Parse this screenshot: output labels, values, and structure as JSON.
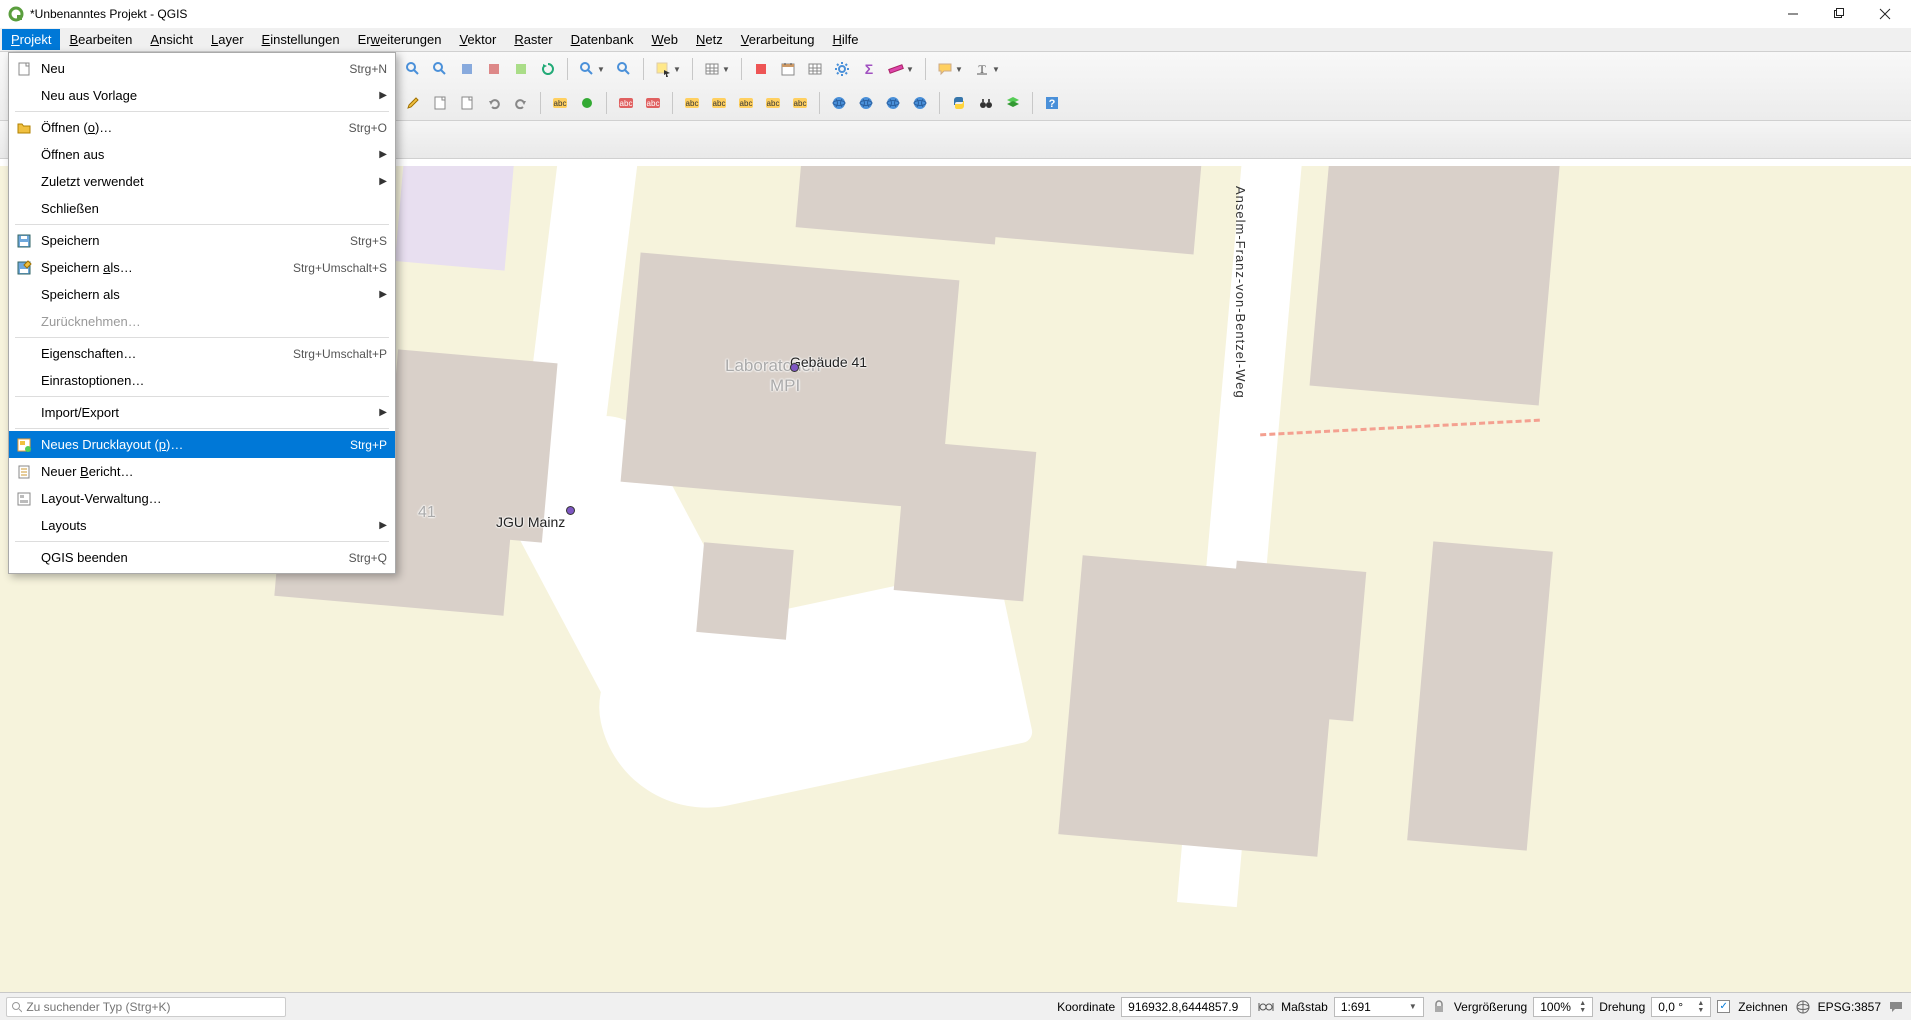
{
  "window": {
    "title": "*Unbenanntes Projekt - QGIS"
  },
  "menubar": {
    "items": [
      {
        "label": "Projekt",
        "accel_index": 0,
        "active": true
      },
      {
        "label": "Bearbeiten",
        "accel_index": 0
      },
      {
        "label": "Ansicht",
        "accel_index": 0
      },
      {
        "label": "Layer",
        "accel_index": 0
      },
      {
        "label": "Einstellungen",
        "accel_index": 0
      },
      {
        "label": "Erweiterungen",
        "accel_index": 2
      },
      {
        "label": "Vektor",
        "accel_index": 0
      },
      {
        "label": "Raster",
        "accel_index": 0
      },
      {
        "label": "Datenbank",
        "accel_index": 0
      },
      {
        "label": "Web",
        "accel_index": 0
      },
      {
        "label": "Netz",
        "accel_index": 0
      },
      {
        "label": "Verarbeitung",
        "accel_index": 0
      },
      {
        "label": "Hilfe",
        "accel_index": 0
      }
    ]
  },
  "dropdown": {
    "items": [
      {
        "label": "Neu",
        "icon": "file",
        "accel": "Strg+N"
      },
      {
        "label": "Neu aus Vorlage",
        "submenu": true
      },
      {
        "sep": true
      },
      {
        "label": "Öffnen (o)…",
        "icon": "folder",
        "accel": "Strg+O",
        "underline_at": 8
      },
      {
        "label": "Öffnen aus",
        "submenu": true
      },
      {
        "label": "Zuletzt verwendet",
        "submenu": true
      },
      {
        "label": "Schließen"
      },
      {
        "sep": true
      },
      {
        "label": "Speichern",
        "icon": "save",
        "accel": "Strg+S"
      },
      {
        "label": "Speichern als…",
        "icon": "save-as",
        "accel": "Strg+Umschalt+S",
        "underline_at": 10
      },
      {
        "label": "Speichern als",
        "submenu": true
      },
      {
        "label": "Zurücknehmen…",
        "disabled": true
      },
      {
        "sep": true
      },
      {
        "label": "Eigenschaften…",
        "accel": "Strg+Umschalt+P"
      },
      {
        "label": "Einrastoptionen…"
      },
      {
        "sep": true
      },
      {
        "label": "Import/Export",
        "submenu": true
      },
      {
        "sep": true
      },
      {
        "label": "Neues Drucklayout (p)…",
        "icon": "new-layout",
        "accel": "Strg+P",
        "highlight": true,
        "underline_at": 19
      },
      {
        "label": "Neuer Bericht…",
        "icon": "report",
        "underline_at": 6
      },
      {
        "label": "Layout-Verwaltung…",
        "icon": "layout-manager"
      },
      {
        "label": "Layouts",
        "submenu": true
      },
      {
        "sep": true
      },
      {
        "label": "QGIS beenden",
        "accel": "Strg+Q"
      }
    ]
  },
  "map": {
    "labels": {
      "building_main": "Laboratorien",
      "building_main2": "MPI",
      "building_41": "Gebäude 41",
      "jgu": "JGU Mainz",
      "num41": "41",
      "road": "Anselm-Franz-von-Bentzel-Weg"
    }
  },
  "statusbar": {
    "search_placeholder": "Zu suchender Typ (Strg+K)",
    "coord_label": "Koordinate",
    "coord_value": "916932.8,6444857.9",
    "scale_label": "Maßstab",
    "scale_value": "1:691",
    "mag_label": "Vergrößerung",
    "mag_value": "100%",
    "rot_label": "Drehung",
    "rot_value": "0,0 °",
    "render_label": "Zeichnen",
    "epsg": "EPSG:3857"
  }
}
